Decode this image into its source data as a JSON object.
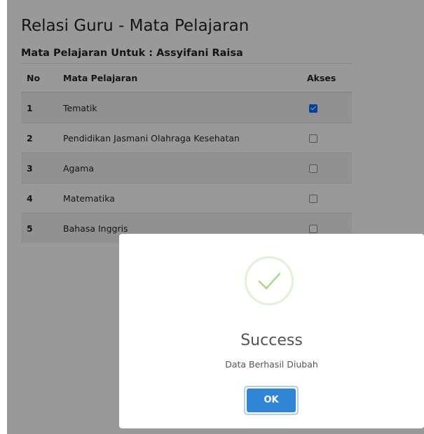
{
  "page": {
    "title": "Relasi Guru - Mata Pelajaran",
    "subtitle": "Mata Pelajaran Untuk : Assyifani Raisa"
  },
  "table": {
    "headers": {
      "no": "No",
      "subject": "Mata Pelajaran",
      "access": "Akses"
    },
    "rows": [
      {
        "no": "1",
        "subject": "Tematik",
        "checked": true
      },
      {
        "no": "2",
        "subject": "Pendidikan Jasmani Olahraga Kesehatan",
        "checked": false
      },
      {
        "no": "3",
        "subject": "Agama",
        "checked": false
      },
      {
        "no": "4",
        "subject": "Matematika",
        "checked": false
      },
      {
        "no": "5",
        "subject": "Bahasa Inggris",
        "checked": false
      }
    ]
  },
  "dialog": {
    "icon": "success-check-icon",
    "title": "Success",
    "message": "Data Berhasil Diubah",
    "ok_label": "OK"
  },
  "colors": {
    "checkbox_checked": "#0d6efd",
    "ok_button": "#3085d6",
    "success_check": "#a5dc86"
  }
}
